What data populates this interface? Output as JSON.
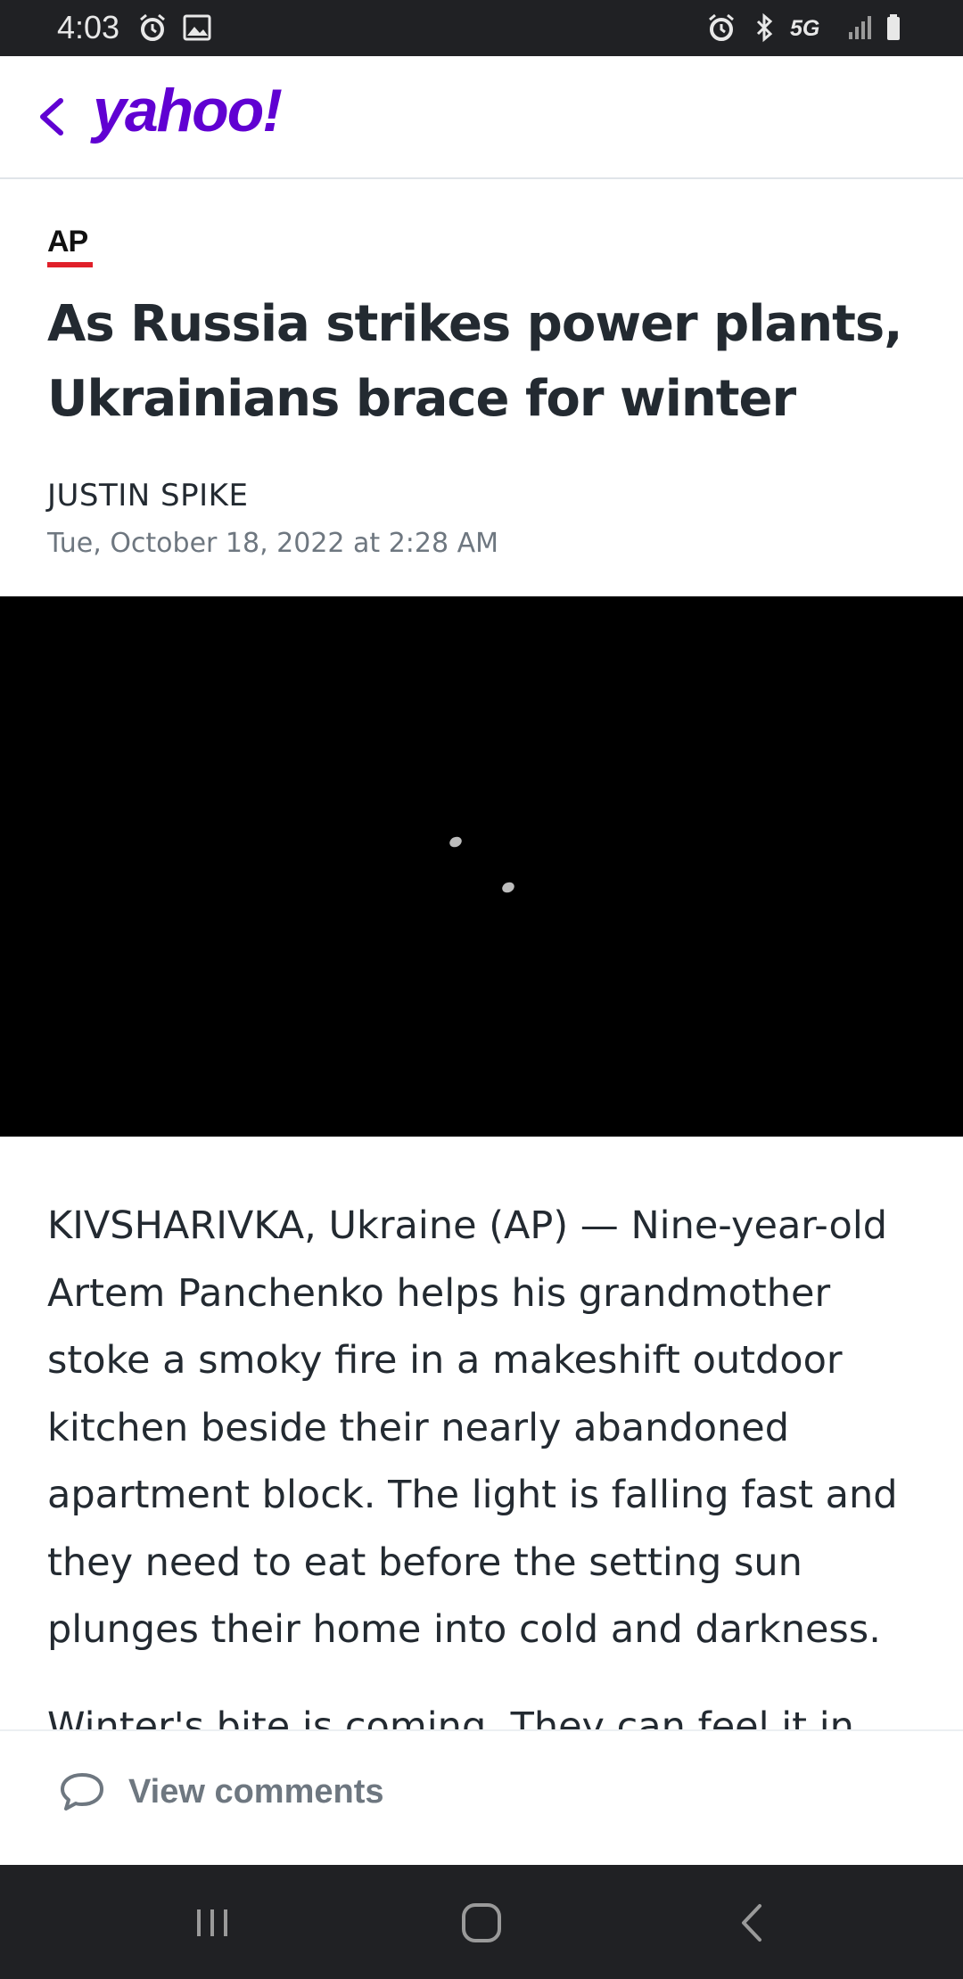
{
  "status_bar": {
    "time": "4:03",
    "network_label": "5G",
    "left_icons": [
      "alarm-icon",
      "image-icon"
    ],
    "right_icons": [
      "alarm-icon",
      "bluetooth-icon",
      "5g-icon",
      "signal-icon",
      "battery-icon"
    ]
  },
  "header": {
    "back_icon": "chevron-left-icon",
    "logo": "yahoo!",
    "accent_color": "#6001d2"
  },
  "article": {
    "source": "AP",
    "headline": "As Russia strikes power plants, Ukrainians brace for winter",
    "author": "JUSTIN SPIKE",
    "date": "Tue, October 18, 2022 at 2:28 AM",
    "video": {
      "state": "loading"
    },
    "paragraphs": [
      "KIVSHARIVKA, Ukraine (AP) — Nine-year-old Artem Panchenko helps his grandmother stoke a smoky fire in a makeshift outdoor kitchen beside their nearly abandoned apartment block. The light is falling fast and they need to eat before the setting sun plunges their home into cold and darkness.",
      "Winter's bite is coming. They can feel it in their"
    ]
  },
  "comments": {
    "label": "View comments",
    "icon": "comment-icon"
  },
  "nav_bar": {
    "buttons": [
      "recent-apps-icon",
      "home-icon",
      "back-icon"
    ]
  }
}
